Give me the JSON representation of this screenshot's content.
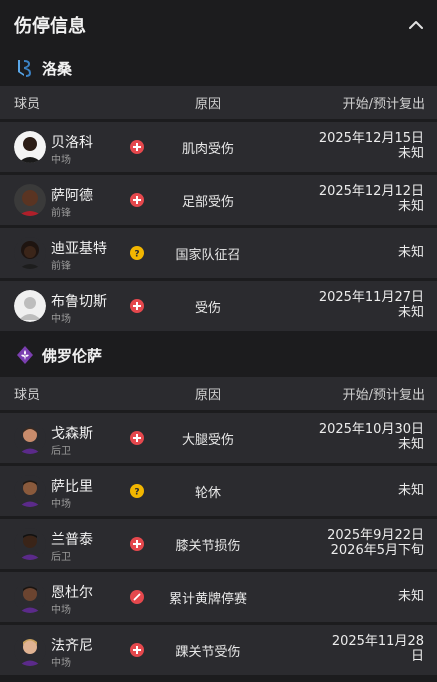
{
  "header": {
    "title": "伤停信息"
  },
  "columns": {
    "player": "球员",
    "reason": "原因",
    "return": "开始/预计复出"
  },
  "teams": [
    {
      "name": "洛桑",
      "players": [
        {
          "name": "贝洛科",
          "position": "中场",
          "badge": "injury",
          "reason": "肌肉受伤",
          "return1": "2025年12月15日",
          "return2": "未知"
        },
        {
          "name": "萨阿德",
          "position": "前锋",
          "badge": "injury",
          "reason": "足部受伤",
          "return1": "2025年12月12日",
          "return2": "未知"
        },
        {
          "name": "迪亚基特",
          "position": "前锋",
          "badge": "question",
          "reason": "国家队征召",
          "return1": "",
          "return2": "未知"
        },
        {
          "name": "布鲁切斯",
          "position": "中场",
          "badge": "injury",
          "reason": "受伤",
          "return1": "2025年11月27日",
          "return2": "未知"
        }
      ]
    },
    {
      "name": "佛罗伦萨",
      "players": [
        {
          "name": "戈森斯",
          "position": "后卫",
          "badge": "injury",
          "reason": "大腿受伤",
          "return1": "2025年10月30日",
          "return2": "未知"
        },
        {
          "name": "萨比里",
          "position": "中场",
          "badge": "question",
          "reason": "轮休",
          "return1": "",
          "return2": "未知"
        },
        {
          "name": "兰普泰",
          "position": "后卫",
          "badge": "injury",
          "reason": "膝关节损伤",
          "return1": "2025年9月22日",
          "return2": "2026年5月下旬"
        },
        {
          "name": "恩杜尔",
          "position": "中场",
          "badge": "suspension",
          "reason": "累计黄牌停赛",
          "return1": "",
          "return2": "未知"
        },
        {
          "name": "法齐尼",
          "position": "中场",
          "badge": "injury",
          "reason": "踝关节受伤",
          "return1": "2025年11月28",
          "return2": "日"
        }
      ]
    }
  ],
  "colors": {
    "injury": "#e5484d",
    "question": "#f2b600",
    "suspension": "#e5484d",
    "background": "#1c1c1e",
    "row": "#2b2b2f"
  }
}
